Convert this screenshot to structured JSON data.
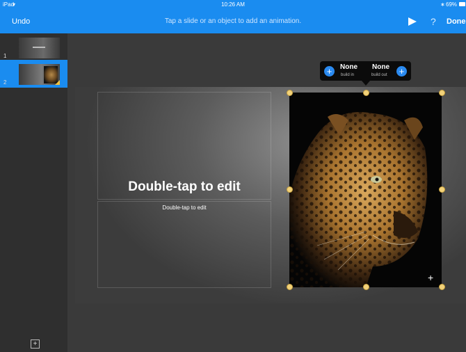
{
  "status_bar": {
    "carrier": "iPad",
    "time": "10:26 AM",
    "battery": "69%"
  },
  "toolbar": {
    "undo_label": "Undo",
    "hint": "Tap a slide or an object to add an animation.",
    "help_label": "?",
    "done_label": "Done"
  },
  "navigator": {
    "slides": [
      {
        "number": "1"
      },
      {
        "number": "2"
      }
    ],
    "selected_index": 1,
    "add_label": "+"
  },
  "slide": {
    "title_placeholder": "Double-tap to edit",
    "body_placeholder": "Double-tap to edit"
  },
  "animation_popover": {
    "build_in": {
      "value": "None",
      "label": "build in"
    },
    "build_out": {
      "value": "None",
      "label": "build out"
    },
    "add_symbol": "+"
  },
  "colors": {
    "accent": "#1a8cf0",
    "handle": "#f2d27a",
    "slide_bg": "#5c5c5c"
  }
}
